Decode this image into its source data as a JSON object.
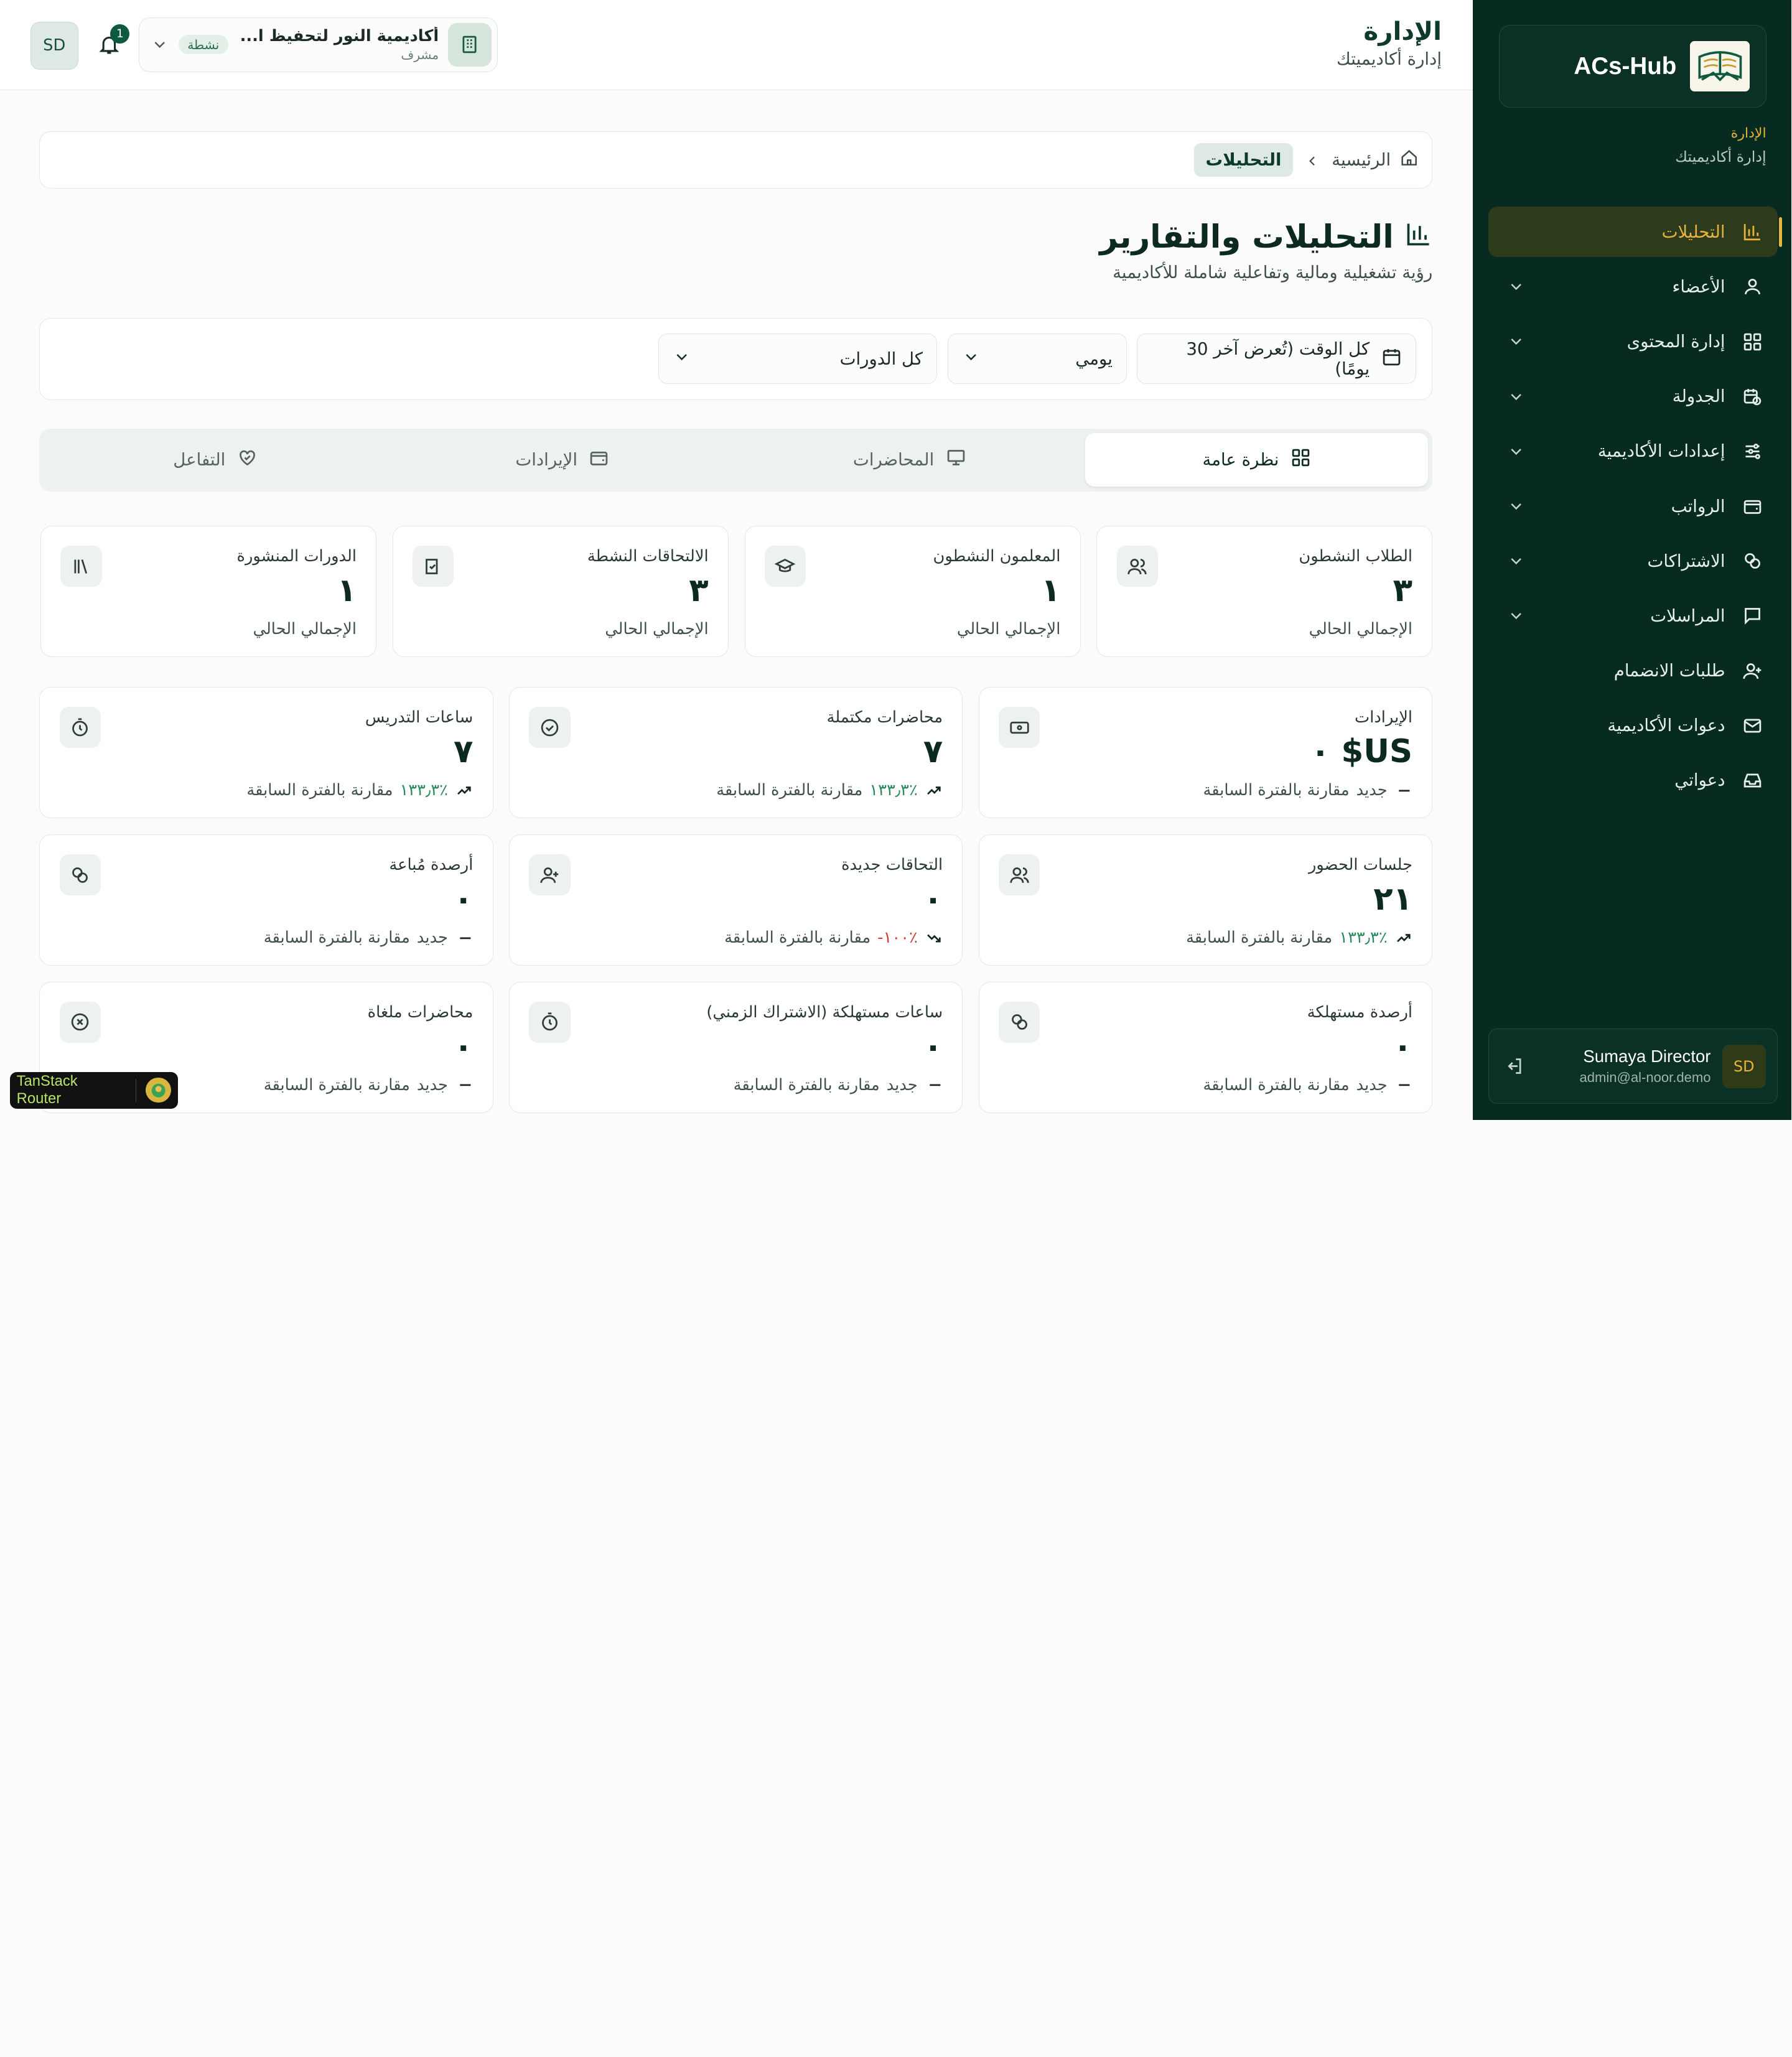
{
  "sidebar": {
    "brand": "ACs-Hub",
    "section_title": "الإدارة",
    "section_subtitle": "إدارة أكاديميتك",
    "items": [
      {
        "label": "التحليلات",
        "icon": "chart-bar-icon",
        "active": true,
        "expandable": false
      },
      {
        "label": "الأعضاء",
        "icon": "user-icon",
        "active": false,
        "expandable": true
      },
      {
        "label": "إدارة المحتوى",
        "icon": "grid-icon",
        "active": false,
        "expandable": true
      },
      {
        "label": "الجدولة",
        "icon": "calendar-clock-icon",
        "active": false,
        "expandable": true
      },
      {
        "label": "إعدادات الأكاديمية",
        "icon": "sliders-icon",
        "active": false,
        "expandable": true
      },
      {
        "label": "الرواتب",
        "icon": "wallet-icon",
        "active": false,
        "expandable": true
      },
      {
        "label": "الاشتراكات",
        "icon": "coins-icon",
        "active": false,
        "expandable": true
      },
      {
        "label": "المراسلات",
        "icon": "message-icon",
        "active": false,
        "expandable": true
      },
      {
        "label": "طلبات الانضمام",
        "icon": "user-plus-icon",
        "active": false,
        "expandable": false
      },
      {
        "label": "دعوات الأكاديمية",
        "icon": "mail-icon",
        "active": false,
        "expandable": false
      },
      {
        "label": "دعواتي",
        "icon": "inbox-icon",
        "active": false,
        "expandable": false
      }
    ],
    "user": {
      "initials": "SD",
      "name": "Sumaya Director",
      "email": "admin@al-noor.demo"
    }
  },
  "header": {
    "title": "الإدارة",
    "subtitle": "إدارة أكاديميتك",
    "academy": {
      "name": "أكاديمية النور لتحفيظ ا...",
      "role": "مشرف",
      "status": "نشطة"
    },
    "notifications": "1",
    "avatar_initials": "SD"
  },
  "breadcrumb": {
    "home": "الرئيسية",
    "current": "التحليلات"
  },
  "page": {
    "title": "التحليلات والتقارير",
    "subtitle": "رؤية تشغيلية ومالية وتفاعلية شاملة للأكاديمية"
  },
  "filters": {
    "date_range": "كل الوقت (تُعرض آخر 30 يومًا)",
    "period": "يومي",
    "course": "كل الدورات"
  },
  "tabs": [
    {
      "label": "نظرة عامة",
      "icon": "grid-icon",
      "active": true
    },
    {
      "label": "المحاضرات",
      "icon": "presentation-icon",
      "active": false
    },
    {
      "label": "الإيرادات",
      "icon": "wallet-icon",
      "active": false
    },
    {
      "label": "التفاعل",
      "icon": "heart-handshake-icon",
      "active": false
    }
  ],
  "kpis_top": [
    {
      "label": "الطلاب النشطون",
      "value": "٣",
      "foot": "الإجمالي الحالي",
      "icon": "users-icon"
    },
    {
      "label": "المعلمون النشطون",
      "value": "١",
      "foot": "الإجمالي الحالي",
      "icon": "graduation-cap-icon"
    },
    {
      "label": "الالتحاقات النشطة",
      "value": "٣",
      "foot": "الإجمالي الحالي",
      "icon": "book-check-icon"
    },
    {
      "label": "الدورات المنشورة",
      "value": "١",
      "foot": "الإجمالي الحالي",
      "icon": "library-icon"
    }
  ],
  "kpis": [
    {
      "label": "الإيرادات",
      "value": "US$ ٠",
      "delta": "جديد",
      "delta_kind": "flat",
      "compare": "مقارنة بالفترة السابقة",
      "icon": "banknote-icon"
    },
    {
      "label": "محاضرات مكتملة",
      "value": "٧",
      "delta": "٪١٣٣٫٣",
      "delta_kind": "up",
      "compare": "مقارنة بالفترة السابقة",
      "icon": "check-circle-icon"
    },
    {
      "label": "ساعات التدريس",
      "value": "٧",
      "delta": "٪١٣٣٫٣",
      "delta_kind": "up",
      "compare": "مقارنة بالفترة السابقة",
      "icon": "timer-icon"
    },
    {
      "label": "جلسات الحضور",
      "value": "٢١",
      "delta": "٪١٣٣٫٣",
      "delta_kind": "up",
      "compare": "مقارنة بالفترة السابقة",
      "icon": "users-icon"
    },
    {
      "label": "التحاقات جديدة",
      "value": "٠",
      "delta": "٪١٠٠-",
      "delta_kind": "down",
      "compare": "مقارنة بالفترة السابقة",
      "icon": "user-plus-icon"
    },
    {
      "label": "أرصدة مُباعة",
      "value": "٠",
      "delta": "جديد",
      "delta_kind": "flat",
      "compare": "مقارنة بالفترة السابقة",
      "icon": "coins-icon"
    },
    {
      "label": "أرصدة مستهلكة",
      "value": "٠",
      "delta": "جديد",
      "delta_kind": "flat",
      "compare": "مقارنة بالفترة السابقة",
      "icon": "coins-icon"
    },
    {
      "label": "ساعات مستهلكة (الاشتراك الزمني)",
      "value": "٠",
      "delta": "جديد",
      "delta_kind": "flat",
      "compare": "مقارنة بالفترة السابقة",
      "icon": "timer-icon"
    },
    {
      "label": "محاضرات ملغاة",
      "value": "٠",
      "delta": "جديد",
      "delta_kind": "flat",
      "compare": "مقارنة بالفترة السابقة",
      "icon": "x-circle-icon"
    }
  ],
  "devtools": {
    "label": "TanStack Router"
  }
}
